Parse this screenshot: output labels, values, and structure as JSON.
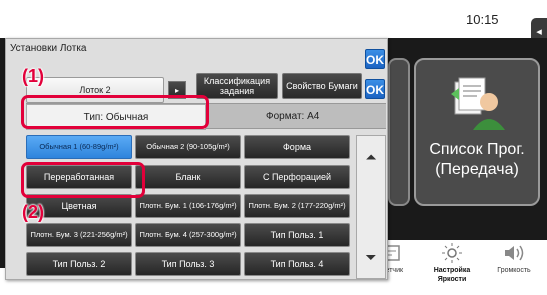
{
  "status": {
    "time": "10:15"
  },
  "home": {
    "program_tile_label": "Список Прог. (Передача)",
    "bottom_bar": [
      {
        "label": "Счетчик",
        "icon": "counter-icon",
        "bold": false
      },
      {
        "label": "Настройка Яркости",
        "icon": "brightness-icon",
        "bold": true
      },
      {
        "label": "Громкость",
        "icon": "volume-icon",
        "bold": false
      }
    ]
  },
  "dialog": {
    "title": "Установки Лотка",
    "ok_label": "OK",
    "tabs": {
      "tray": "Лоток 2",
      "classification": "Классификация задания",
      "paper_property": "Свойство Бумаги"
    },
    "info": {
      "type": "Тип:   Обычная",
      "format": "Формат:   A4"
    },
    "paper_types": [
      [
        "Обычная 1 (60-89g/m²)",
        "Обычная 2 (90-105g/m²)",
        "Форма"
      ],
      [
        "Переработанная",
        "Бланк",
        "С Перфорацией"
      ],
      [
        "Цветная",
        "Плотн. Бум. 1 (106-176g/m²)",
        "Плотн. Бум. 2 (177-220g/m²)"
      ],
      [
        "Плотн. Бум. 3 (221-256g/m²)",
        "Плотн. Бум. 4 (257-300g/m²)",
        "Тип Польз. 1"
      ],
      [
        "Тип Польз. 2",
        "Тип Польз. 3",
        "Тип Польз. 4"
      ]
    ]
  },
  "markers": {
    "one": "(1)",
    "two": "(2)"
  },
  "colors": {
    "highlight": "#e2003a",
    "selected": "#3b92e6",
    "ok": "#1b63c2"
  }
}
